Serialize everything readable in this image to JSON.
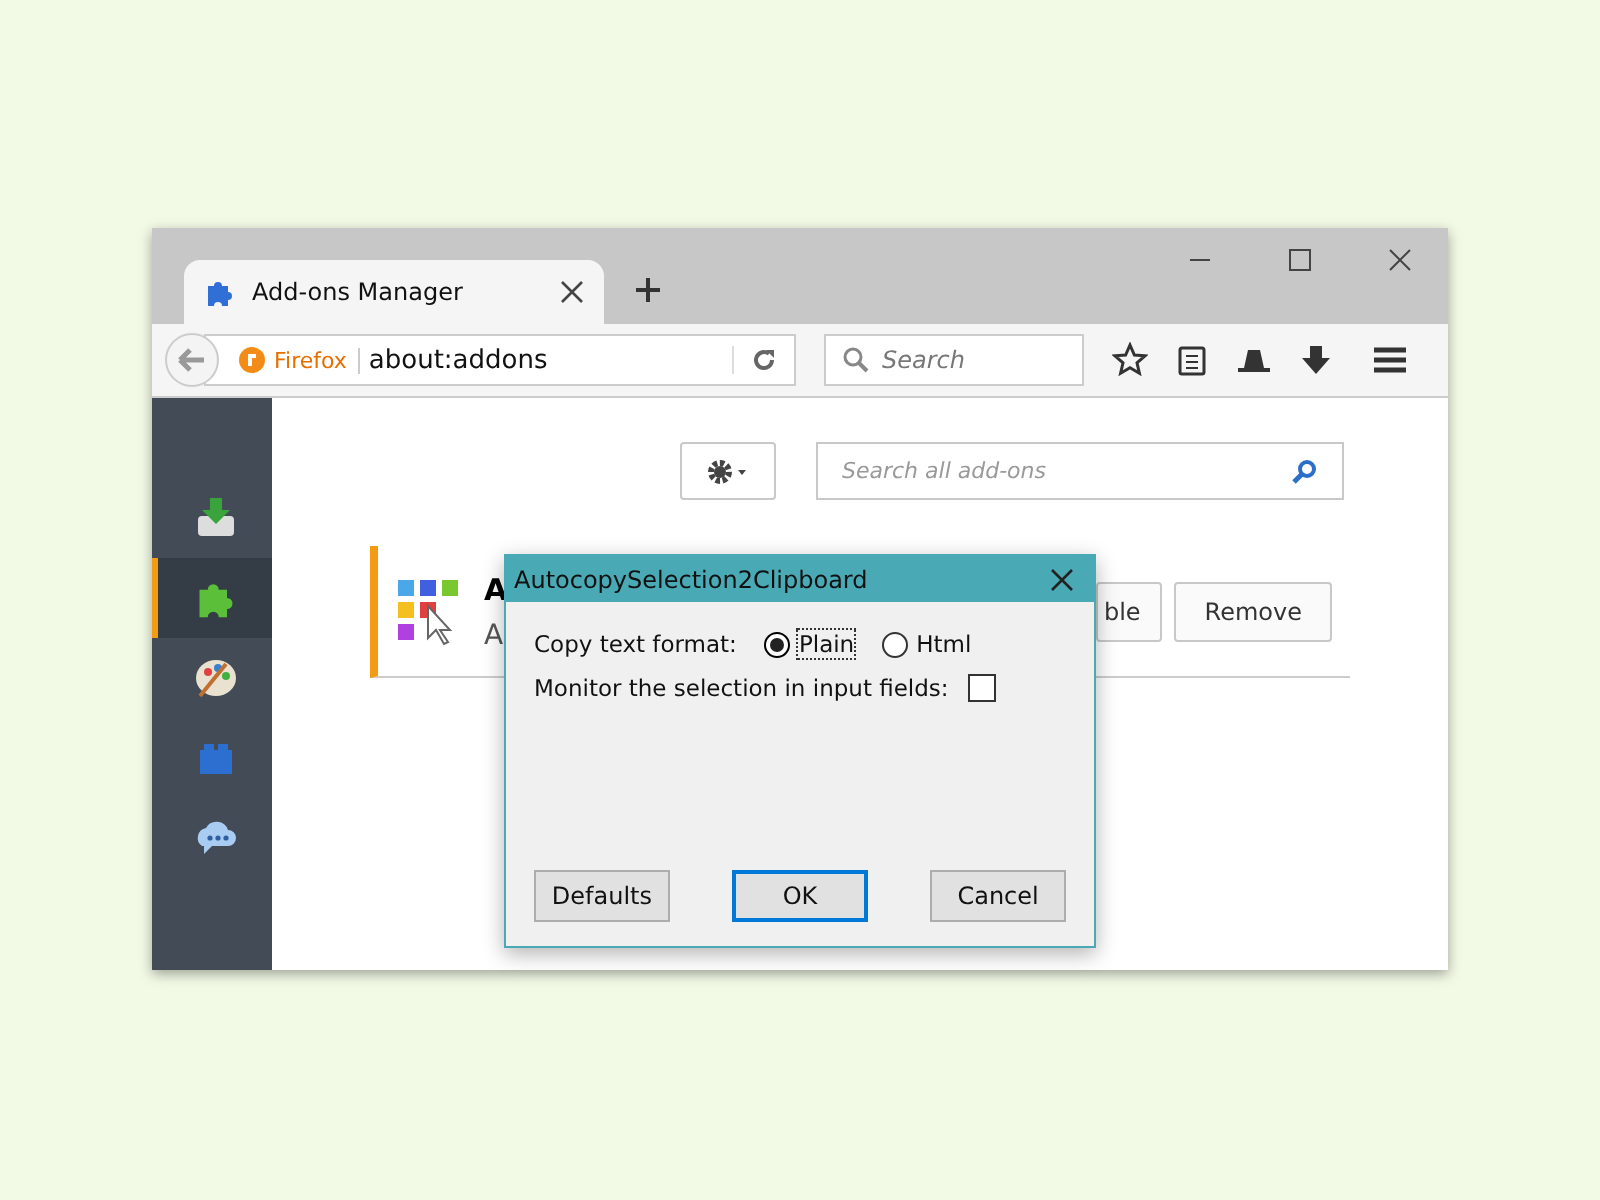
{
  "tab": {
    "title": "Add-ons Manager"
  },
  "toolbar": {
    "identity": "Firefox",
    "url": "about:addons",
    "search_placeholder": "Search"
  },
  "sidebar": [
    {
      "kind": "get",
      "selected": false
    },
    {
      "kind": "extensions",
      "selected": true
    },
    {
      "kind": "appearance",
      "selected": false
    },
    {
      "kind": "plugins",
      "selected": false
    },
    {
      "kind": "services",
      "selected": false
    }
  ],
  "content": {
    "search_placeholder": "Search all add-ons"
  },
  "addon": {
    "name": "A",
    "description": "A",
    "buttons": [
      "ble",
      "Remove"
    ]
  },
  "dialog": {
    "title": "AutocopySelection2Clipboard",
    "format_label": "Copy text format:",
    "options": [
      {
        "label": "Plain",
        "selected": true
      },
      {
        "label": "Html",
        "selected": false
      }
    ],
    "monitor": {
      "label": "Monitor the selection in input fields:",
      "checked": false
    },
    "buttons": [
      {
        "label": "Defaults",
        "default": false
      },
      {
        "label": "OK",
        "default": true
      },
      {
        "label": "Cancel",
        "default": false
      }
    ]
  }
}
